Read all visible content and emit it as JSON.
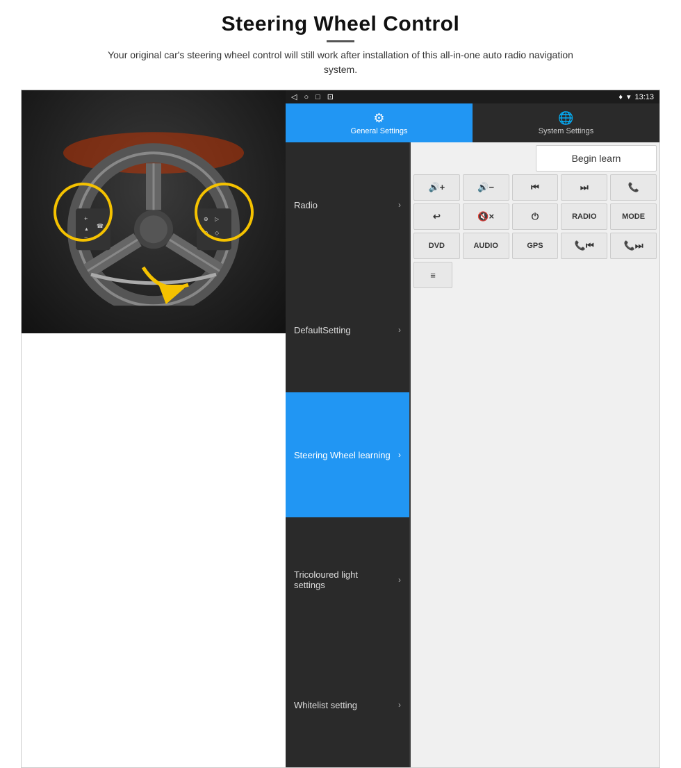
{
  "header": {
    "title": "Steering Wheel Control",
    "subtitle": "Your original car's steering wheel control will still work after installation of this all-in-one auto radio navigation system."
  },
  "status_bar": {
    "time": "13:13",
    "icons_left": [
      "◁",
      "○",
      "□",
      "⊡"
    ]
  },
  "tabs": [
    {
      "label": "General Settings",
      "icon": "⚙",
      "active": true
    },
    {
      "label": "System Settings",
      "icon": "🌐",
      "active": false
    }
  ],
  "menu_items": [
    {
      "label": "Radio",
      "active": false
    },
    {
      "label": "DefaultSetting",
      "active": false
    },
    {
      "label": "Steering Wheel learning",
      "active": true
    },
    {
      "label": "Tricoloured light settings",
      "active": false
    },
    {
      "label": "Whitelist setting",
      "active": false
    }
  ],
  "controls": {
    "begin_learn_label": "Begin learn",
    "row1": [
      {
        "symbol": "🔊+",
        "label": "vol_up"
      },
      {
        "symbol": "🔊−",
        "label": "vol_down"
      },
      {
        "symbol": "⏮",
        "label": "prev"
      },
      {
        "symbol": "⏭",
        "label": "next"
      },
      {
        "symbol": "📞",
        "label": "phone"
      }
    ],
    "row2": [
      {
        "symbol": "↩",
        "label": "back"
      },
      {
        "symbol": "🔇×",
        "label": "mute"
      },
      {
        "symbol": "⏻",
        "label": "power"
      },
      {
        "symbol": "RADIO",
        "label": "radio"
      },
      {
        "symbol": "MODE",
        "label": "mode"
      }
    ],
    "row3": [
      {
        "symbol": "DVD",
        "label": "dvd"
      },
      {
        "symbol": "AUDIO",
        "label": "audio"
      },
      {
        "symbol": "GPS",
        "label": "gps"
      },
      {
        "symbol": "📞⏮",
        "label": "call_prev"
      },
      {
        "symbol": "📞⏭",
        "label": "call_next"
      }
    ],
    "row4_icon": "≡"
  }
}
